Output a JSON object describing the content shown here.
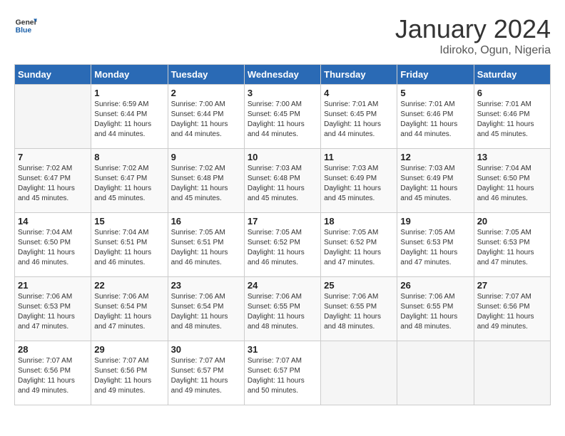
{
  "header": {
    "logo_line1": "General",
    "logo_line2": "Blue",
    "month": "January 2024",
    "location": "Idiroko, Ogun, Nigeria"
  },
  "days_of_week": [
    "Sunday",
    "Monday",
    "Tuesday",
    "Wednesday",
    "Thursday",
    "Friday",
    "Saturday"
  ],
  "weeks": [
    [
      {
        "day": "",
        "info": ""
      },
      {
        "day": "1",
        "info": "Sunrise: 6:59 AM\nSunset: 6:44 PM\nDaylight: 11 hours\nand 44 minutes."
      },
      {
        "day": "2",
        "info": "Sunrise: 7:00 AM\nSunset: 6:44 PM\nDaylight: 11 hours\nand 44 minutes."
      },
      {
        "day": "3",
        "info": "Sunrise: 7:00 AM\nSunset: 6:45 PM\nDaylight: 11 hours\nand 44 minutes."
      },
      {
        "day": "4",
        "info": "Sunrise: 7:01 AM\nSunset: 6:45 PM\nDaylight: 11 hours\nand 44 minutes."
      },
      {
        "day": "5",
        "info": "Sunrise: 7:01 AM\nSunset: 6:46 PM\nDaylight: 11 hours\nand 44 minutes."
      },
      {
        "day": "6",
        "info": "Sunrise: 7:01 AM\nSunset: 6:46 PM\nDaylight: 11 hours\nand 45 minutes."
      }
    ],
    [
      {
        "day": "7",
        "info": "Sunrise: 7:02 AM\nSunset: 6:47 PM\nDaylight: 11 hours\nand 45 minutes."
      },
      {
        "day": "8",
        "info": "Sunrise: 7:02 AM\nSunset: 6:47 PM\nDaylight: 11 hours\nand 45 minutes."
      },
      {
        "day": "9",
        "info": "Sunrise: 7:02 AM\nSunset: 6:48 PM\nDaylight: 11 hours\nand 45 minutes."
      },
      {
        "day": "10",
        "info": "Sunrise: 7:03 AM\nSunset: 6:48 PM\nDaylight: 11 hours\nand 45 minutes."
      },
      {
        "day": "11",
        "info": "Sunrise: 7:03 AM\nSunset: 6:49 PM\nDaylight: 11 hours\nand 45 minutes."
      },
      {
        "day": "12",
        "info": "Sunrise: 7:03 AM\nSunset: 6:49 PM\nDaylight: 11 hours\nand 45 minutes."
      },
      {
        "day": "13",
        "info": "Sunrise: 7:04 AM\nSunset: 6:50 PM\nDaylight: 11 hours\nand 46 minutes."
      }
    ],
    [
      {
        "day": "14",
        "info": "Sunrise: 7:04 AM\nSunset: 6:50 PM\nDaylight: 11 hours\nand 46 minutes."
      },
      {
        "day": "15",
        "info": "Sunrise: 7:04 AM\nSunset: 6:51 PM\nDaylight: 11 hours\nand 46 minutes."
      },
      {
        "day": "16",
        "info": "Sunrise: 7:05 AM\nSunset: 6:51 PM\nDaylight: 11 hours\nand 46 minutes."
      },
      {
        "day": "17",
        "info": "Sunrise: 7:05 AM\nSunset: 6:52 PM\nDaylight: 11 hours\nand 46 minutes."
      },
      {
        "day": "18",
        "info": "Sunrise: 7:05 AM\nSunset: 6:52 PM\nDaylight: 11 hours\nand 47 minutes."
      },
      {
        "day": "19",
        "info": "Sunrise: 7:05 AM\nSunset: 6:53 PM\nDaylight: 11 hours\nand 47 minutes."
      },
      {
        "day": "20",
        "info": "Sunrise: 7:05 AM\nSunset: 6:53 PM\nDaylight: 11 hours\nand 47 minutes."
      }
    ],
    [
      {
        "day": "21",
        "info": "Sunrise: 7:06 AM\nSunset: 6:53 PM\nDaylight: 11 hours\nand 47 minutes."
      },
      {
        "day": "22",
        "info": "Sunrise: 7:06 AM\nSunset: 6:54 PM\nDaylight: 11 hours\nand 47 minutes."
      },
      {
        "day": "23",
        "info": "Sunrise: 7:06 AM\nSunset: 6:54 PM\nDaylight: 11 hours\nand 48 minutes."
      },
      {
        "day": "24",
        "info": "Sunrise: 7:06 AM\nSunset: 6:55 PM\nDaylight: 11 hours\nand 48 minutes."
      },
      {
        "day": "25",
        "info": "Sunrise: 7:06 AM\nSunset: 6:55 PM\nDaylight: 11 hours\nand 48 minutes."
      },
      {
        "day": "26",
        "info": "Sunrise: 7:06 AM\nSunset: 6:55 PM\nDaylight: 11 hours\nand 48 minutes."
      },
      {
        "day": "27",
        "info": "Sunrise: 7:07 AM\nSunset: 6:56 PM\nDaylight: 11 hours\nand 49 minutes."
      }
    ],
    [
      {
        "day": "28",
        "info": "Sunrise: 7:07 AM\nSunset: 6:56 PM\nDaylight: 11 hours\nand 49 minutes."
      },
      {
        "day": "29",
        "info": "Sunrise: 7:07 AM\nSunset: 6:56 PM\nDaylight: 11 hours\nand 49 minutes."
      },
      {
        "day": "30",
        "info": "Sunrise: 7:07 AM\nSunset: 6:57 PM\nDaylight: 11 hours\nand 49 minutes."
      },
      {
        "day": "31",
        "info": "Sunrise: 7:07 AM\nSunset: 6:57 PM\nDaylight: 11 hours\nand 50 minutes."
      },
      {
        "day": "",
        "info": ""
      },
      {
        "day": "",
        "info": ""
      },
      {
        "day": "",
        "info": ""
      }
    ]
  ]
}
